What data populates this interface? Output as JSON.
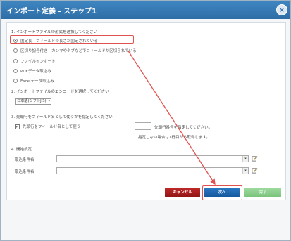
{
  "dialog": {
    "title": "インポート定義 - ステップ1",
    "close_symbol": "×"
  },
  "section1": {
    "title": "1. インポートファイルの形式を選択してください",
    "options": [
      "固定長 - フィールドの長さが固定されている",
      "区切り記号付き - カンマやタブなどでフィールドが区切られている",
      "ファイルインポート",
      "PDFデータ取込み",
      "Excelデータ取込み"
    ],
    "selected_index": 0
  },
  "section2": {
    "title": "2. インポートファイルのエンコードを選択してください",
    "encoding_value": "日本語(シフトJIS)"
  },
  "section3": {
    "title": "3. 先頭行をフィールド名として使うかを指定してください",
    "checkbox_label": "先頭行をフィールド名として使う",
    "checkbox_checked": true,
    "note1": "先頭行番号を指定してください。",
    "note2": "指定しない場合は1行目から取得します。"
  },
  "section4": {
    "title": "4. 開始設定",
    "row1_label": "取込条件名",
    "row2_label": "取込条件名"
  },
  "buttons": {
    "cancel": "キャンセル",
    "next": "次へ",
    "finish": "完了"
  },
  "colors": {
    "title_bar": "#3478b6",
    "highlight": "#e0524f",
    "cancel": "#a81e1e",
    "next": "#1f69b0",
    "finish": "#8ccf8e"
  }
}
